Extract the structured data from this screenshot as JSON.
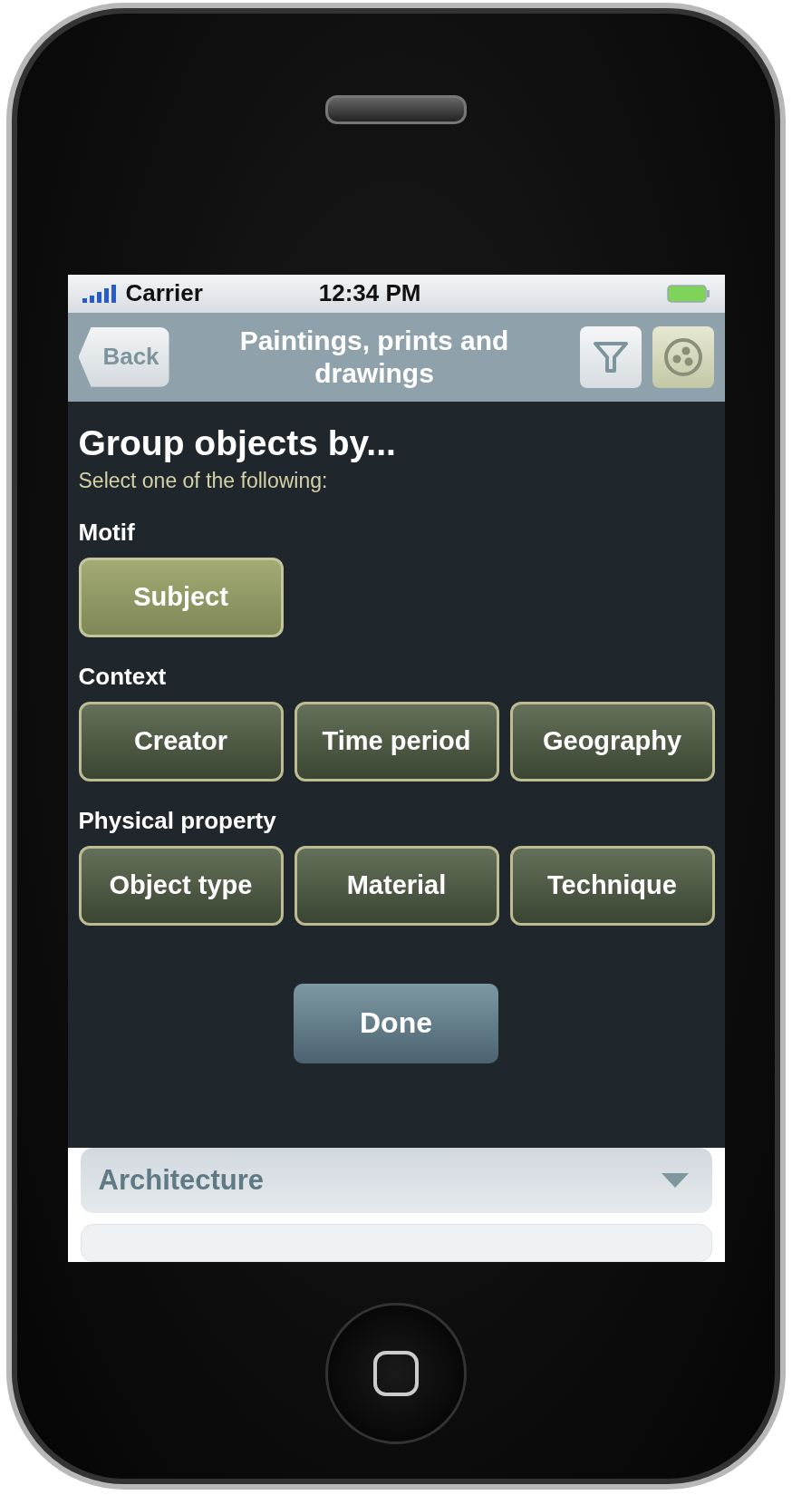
{
  "status_bar": {
    "carrier": "Carrier",
    "time": "12:34 PM"
  },
  "nav_bar": {
    "back": "Back",
    "title": "Paintings, prints and drawings"
  },
  "group_sheet": {
    "title": "Group objects by...",
    "subtitle": "Select one of the following:",
    "sections": [
      {
        "label": "Motif",
        "options": [
          {
            "label": "Subject",
            "selected": true
          }
        ]
      },
      {
        "label": "Context",
        "options": [
          {
            "label": "Creator",
            "selected": false
          },
          {
            "label": "Time period",
            "selected": false
          },
          {
            "label": "Geography",
            "selected": false
          }
        ]
      },
      {
        "label": "Physical property",
        "options": [
          {
            "label": "Object type",
            "selected": false
          },
          {
            "label": "Material",
            "selected": false
          },
          {
            "label": "Technique",
            "selected": false
          }
        ]
      }
    ],
    "done": "Done"
  },
  "list": [
    {
      "label": "Architecture"
    }
  ]
}
